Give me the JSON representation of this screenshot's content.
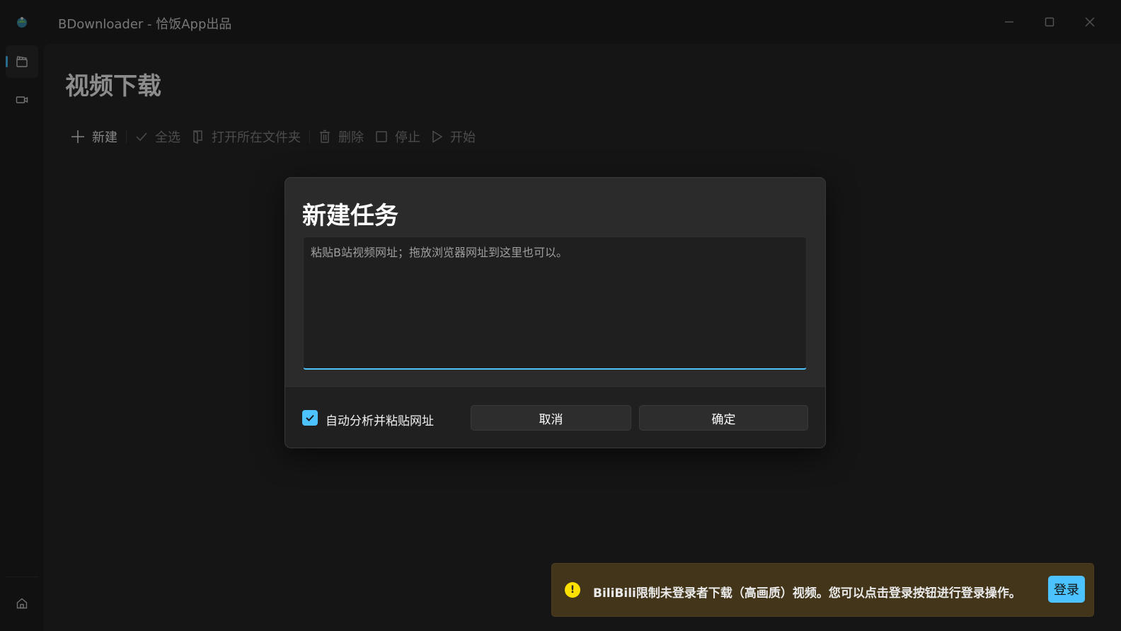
{
  "window": {
    "title": "BDownloader - 恰饭App出品",
    "minimize_icon": "minimize-icon",
    "maximize_icon": "maximize-icon",
    "close_icon": "close-icon"
  },
  "nav": {
    "items": [
      {
        "icon": "video-folder-icon",
        "active": true
      },
      {
        "icon": "video-camera-icon",
        "active": false
      }
    ],
    "footer_icon": "home-icon"
  },
  "page": {
    "title": "视频下载"
  },
  "toolbar": {
    "new_label": "新建",
    "select_all_label": "全选",
    "open_folder_label": "打开所在文件夹",
    "delete_label": "删除",
    "stop_label": "停止",
    "start_label": "开始"
  },
  "dialog": {
    "title": "新建任务",
    "url_placeholder": "粘贴B站视频网址；拖放浏览器网址到这里也可以。",
    "url_value": "",
    "auto_paste_label": "自动分析并粘贴网址",
    "auto_paste_checked": true,
    "cancel_label": "取消",
    "confirm_label": "确定"
  },
  "infobar": {
    "message": "BiliBili限制未登录者下载（高画质）视频。您可以点击登录按钮进行登录操作。",
    "icon_glyph": "!",
    "login_label": "登录",
    "severity_color": "#fce100"
  },
  "colors": {
    "accent": "#4cc2ff",
    "background": "#202020",
    "warning_bg": "#433519"
  }
}
